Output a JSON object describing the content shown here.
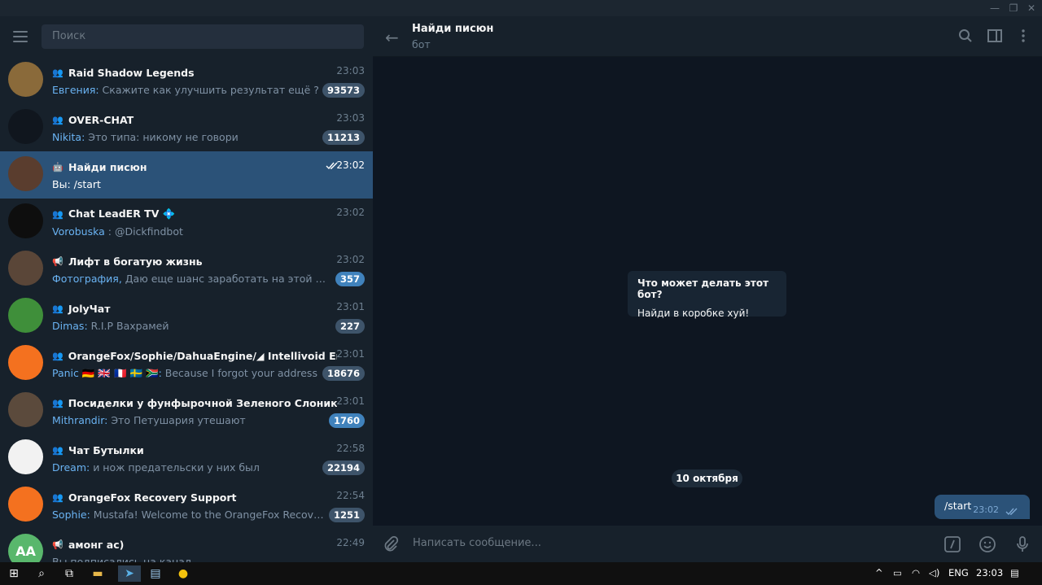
{
  "search": {
    "placeholder": "Поиск"
  },
  "chats": [
    {
      "name": "Raid Shadow Legends",
      "type": "group",
      "time": "23:03",
      "sender": "Евгения:",
      "message": " Скажите как улучшить результат ещё ?",
      "badge": "93573",
      "badge_style": "muted",
      "avatar_color": "#8a6a3a"
    },
    {
      "name": "OVER-CHAT",
      "type": "group",
      "time": "23:03",
      "sender": "Nikita:",
      "message": " Это типа: никому не говори",
      "badge": "11213",
      "badge_style": "muted",
      "avatar_color": "#10161e"
    },
    {
      "name": "Найди писюн",
      "type": "bot",
      "time": "23:02",
      "sender": "Вы:",
      "message": " /start",
      "badge": "",
      "badge_style": "",
      "active": true,
      "avatar_color": "#5a3d2e"
    },
    {
      "name": "Chat LeadER TV 💠",
      "type": "group",
      "time": "23:02",
      "sender": "Vorobuska",
      "message": "    : @Dickfindbot",
      "badge": "",
      "badge_style": "",
      "avatar_color": "#0e0e0e"
    },
    {
      "name": "Лифт в богатую жизнь",
      "type": "channel",
      "time": "23:02",
      "sender": "Фотография,",
      "message": " Даю еще шанс заработать на этой неделе Пи...",
      "badge": "357",
      "badge_style": "blue",
      "avatar_color": "#5a4638"
    },
    {
      "name": "JolyЧат",
      "type": "group",
      "time": "23:01",
      "sender": "Dimas:",
      "message": " R.I.P Вахрамей",
      "badge": "227",
      "badge_style": "muted",
      "avatar_color": "#3f8f3a"
    },
    {
      "name": "OrangeFox/Sophie/DahuaEngine/◢ Intellivoid English/...",
      "type": "group",
      "time": "23:01",
      "sender": "Panic 🇩🇪 🇬🇧 🇫🇷 🇸🇪 🇿🇦:",
      "message": " Because I forgot your address",
      "badge": "18676",
      "badge_style": "muted",
      "avatar_color": "#f4711f"
    },
    {
      "name": "Посиделки у фунфырочной Зеленого Слоника",
      "type": "group",
      "time": "23:01",
      "sender": "Mithrandir:",
      "message": " Это Петушария утешают",
      "badge": "1760",
      "badge_style": "blue",
      "avatar_color": "#5b4a3c"
    },
    {
      "name": "Чат Бутылки",
      "type": "group",
      "time": "22:58",
      "sender": "Dream:",
      "message": " и нож предательски у них был",
      "badge": "22194",
      "badge_style": "muted",
      "avatar_color": "#f2f2f2"
    },
    {
      "name": "OrangeFox Recovery Support",
      "type": "group",
      "time": "22:54",
      "sender": "Sophie:",
      "message": " Mustafa! Welcome to the OrangeFox Recovery Supp...",
      "badge": "1251",
      "badge_style": "muted",
      "avatar_color": "#f4711f"
    },
    {
      "name": "амонг ас)",
      "type": "channel",
      "time": "22:49",
      "sender": "",
      "message": "Вы подписались на канал",
      "badge": "",
      "badge_style": "",
      "avatar_color": "#59b76c",
      "initials": "AA"
    }
  ],
  "header": {
    "title": "Найди писюн",
    "subtitle": "бот"
  },
  "bot_info": {
    "heading": "Что может делать этот бот?",
    "text": "Найди в коробке хуй!"
  },
  "date_separator": "10 октября",
  "message": {
    "text": "/start",
    "time": "23:02"
  },
  "composer": {
    "placeholder": "Написать сообщение..."
  },
  "taskbar": {
    "lang": "ENG",
    "time": "23:03"
  }
}
